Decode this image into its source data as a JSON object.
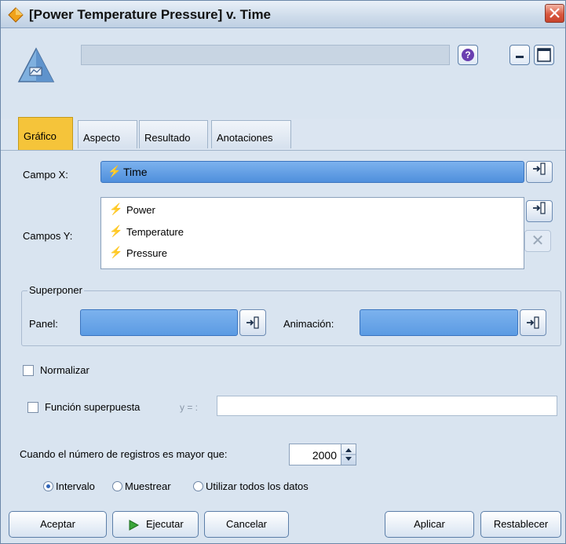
{
  "window": {
    "title": "[Power Temperature Pressure] v. Time",
    "help_icon": "question-mark-icon",
    "minimize_icon": "minimize-icon",
    "maximize_icon": "maximize-icon",
    "close_icon": "close-icon",
    "node_icon": "plot-node-icon"
  },
  "tabs": [
    {
      "label": "Gráfico",
      "active": true
    },
    {
      "label": "Aspecto",
      "active": false
    },
    {
      "label": "Resultado",
      "active": false
    },
    {
      "label": "Anotaciones",
      "active": false
    }
  ],
  "fields": {
    "x_label": "Campo X:",
    "x_value": "Time",
    "y_label": "Campos Y:",
    "y_values": [
      "Power",
      "Temperature",
      "Pressure"
    ]
  },
  "overlay": {
    "title": "Superponer",
    "panel_label": "Panel:",
    "panel_value": "",
    "animation_label": "Animación:",
    "animation_value": ""
  },
  "options": {
    "normalize_label": "Normalizar",
    "normalize_checked": false,
    "overlay_fn_label": "Función superpuesta",
    "overlay_fn_checked": false,
    "y_eq_label": "y = :",
    "y_eq_value": ""
  },
  "records": {
    "label": "Cuando el número de registros es mayor que:",
    "value": "2000",
    "radio_interval": "Intervalo",
    "radio_sample": "Muestrear",
    "radio_all": "Utilizar todos los datos",
    "selected": "Intervalo"
  },
  "buttons": {
    "ok": "Aceptar",
    "run": "Ejecutar",
    "cancel": "Cancelar",
    "apply": "Aplicar",
    "reset": "Restablecer"
  },
  "colors": {
    "accent_tab": "#f5c43a",
    "field_blue": "#5b9be3",
    "panel_bg": "#d9e4f0"
  }
}
